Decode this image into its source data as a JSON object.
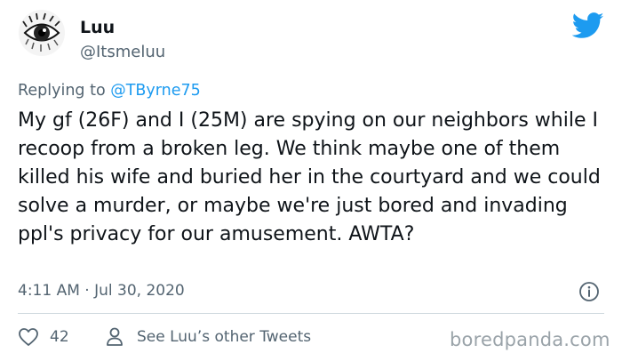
{
  "author": {
    "display_name": "Luu",
    "handle": "@Itsmeluu",
    "avatar_icon": "eye-sketch-icon"
  },
  "brand": {
    "icon": "twitter-bird-icon",
    "color": "#1d9bf0"
  },
  "reply": {
    "prefix": "Replying to ",
    "mention": "@TByrne75"
  },
  "tweet": {
    "text": "My gf (26F) and I (25M) are spying on our neighbors while I recoop from a broken leg. We think maybe one of them killed his wife and buried her in the courtyard and we could solve a murder, or maybe we're just bored and invading ppl's privacy for our amusement. AWTA?",
    "timestamp": "4:11 AM · Jul 30, 2020"
  },
  "footer": {
    "likes_count": "42",
    "like_icon": "heart-icon",
    "see_tweets_icon": "person-icon",
    "see_tweets_label": "See Luu’s other Tweets",
    "info_icon": "info-icon"
  },
  "watermark": "boredpanda.com",
  "colors": {
    "text": "#0f1419",
    "secondary": "#536471",
    "link": "#1d9bf0",
    "divider": "#cfd9de"
  }
}
